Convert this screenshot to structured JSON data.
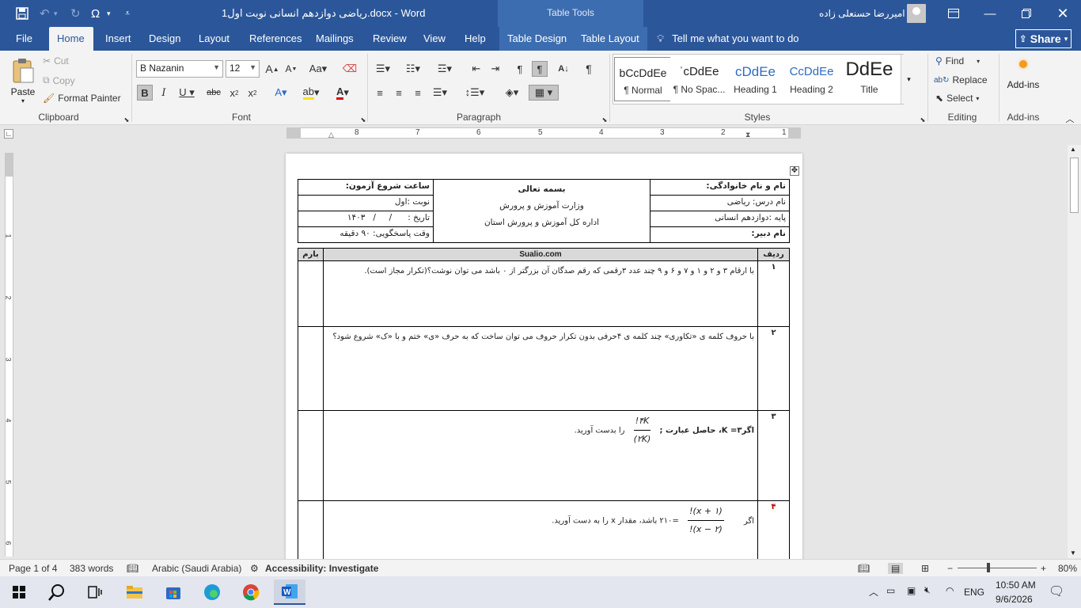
{
  "window": {
    "title": "ریاضی دوازدهم انسانی نوبت اول1.docx  -  Word",
    "contextual_label": "Table Tools",
    "user_name": "امیررضا حسنعلی زاده"
  },
  "tabs": [
    "File",
    "Home",
    "Insert",
    "Design",
    "Layout",
    "References",
    "Mailings",
    "Review",
    "View",
    "Help",
    "Table Design",
    "Table Layout"
  ],
  "tell_me": "Tell me what you want to do",
  "share_label": "Share",
  "ribbon": {
    "clipboard": {
      "label": "Clipboard",
      "paste": "Paste",
      "cut": "Cut",
      "copy": "Copy",
      "format_painter": "Format Painter"
    },
    "font": {
      "label": "Font",
      "font_name": "B Nazanin",
      "font_size": "12"
    },
    "paragraph": {
      "label": "Paragraph"
    },
    "styles": {
      "label": "Styles",
      "items": [
        {
          "preview": "bCcDdEe",
          "name": "¶ Normal"
        },
        {
          "preview": "ˈcDdEe",
          "name": "¶ No Spac..."
        },
        {
          "preview": "cDdEe",
          "name": "Heading 1"
        },
        {
          "preview": "CcDdEe",
          "name": "Heading 2"
        },
        {
          "preview": "DdEe",
          "name": "Title"
        }
      ]
    },
    "editing": {
      "label": "Editing",
      "find": "Find",
      "replace": "Replace",
      "select": "Select"
    },
    "addins": {
      "label": "Add-ins",
      "button": "Add-ins"
    }
  },
  "ruler_numbers": [
    "8",
    "7",
    "6",
    "5",
    "4",
    "3",
    "2",
    "1"
  ],
  "document": {
    "header": {
      "family_name": "نام و نام خانوادگی:",
      "subject": "نام درس: ریاضی",
      "grade": "پایه :دوازدهم انسانی",
      "teacher": "نام دبیر:",
      "center_line1": "بسمه تعالی",
      "center_line2": "وزارت آموزش و پرورش",
      "center_line3": "اداره کل آموزش و پرورش استان",
      "start_time": "ساعت شروع آزمون:",
      "term": "نوبت :اول",
      "date": "تاریخ :      /     /   ۱۴۰۳",
      "duration": "وقت پاسخگویی: ۹۰ دقیقه"
    },
    "columns": {
      "row": "ردیف",
      "site": "Sualio.com",
      "score": "بارم"
    },
    "questions": [
      {
        "num": "۱",
        "text": "با ارقام ۳ و ۲ و ۱ و ۷ و ۶ و ۹ چند عدد ۳رقمی که رقم صدگان آن بزرگتر از ۰ باشد می توان نوشت؟(تکرار مجاز است)."
      },
      {
        "num": "۲",
        "text": "با حروف کلمه ی «تکاوری» چند کلمه ی ۴حرفی بدون تکرار حروف می توان ساخت که به حرف «ی» ختم و با «ک» شروع شود؟"
      },
      {
        "num": "۳",
        "text_a": "اگر۳= K، حاصل عبارت ;",
        "frac_num": "۴K!",
        "frac_den": "(۲K)",
        "text_b": "را بدست آورید."
      },
      {
        "num": "۴",
        "text_a": "اگر",
        "frac_num": "(x + ۱)!",
        "frac_den": "(x − ۲)!",
        "text_b": "=۲۱۰ باشد، مقدار x را به دست آورید."
      }
    ]
  },
  "status": {
    "page": "Page 1 of 4",
    "words": "383 words",
    "language": "Arabic (Saudi Arabia)",
    "accessibility": "Accessibility: Investigate",
    "zoom": "80%"
  },
  "taskbar": {
    "time": "10:50 AM",
    "date": "9/6/2026",
    "lang": "ENG"
  }
}
